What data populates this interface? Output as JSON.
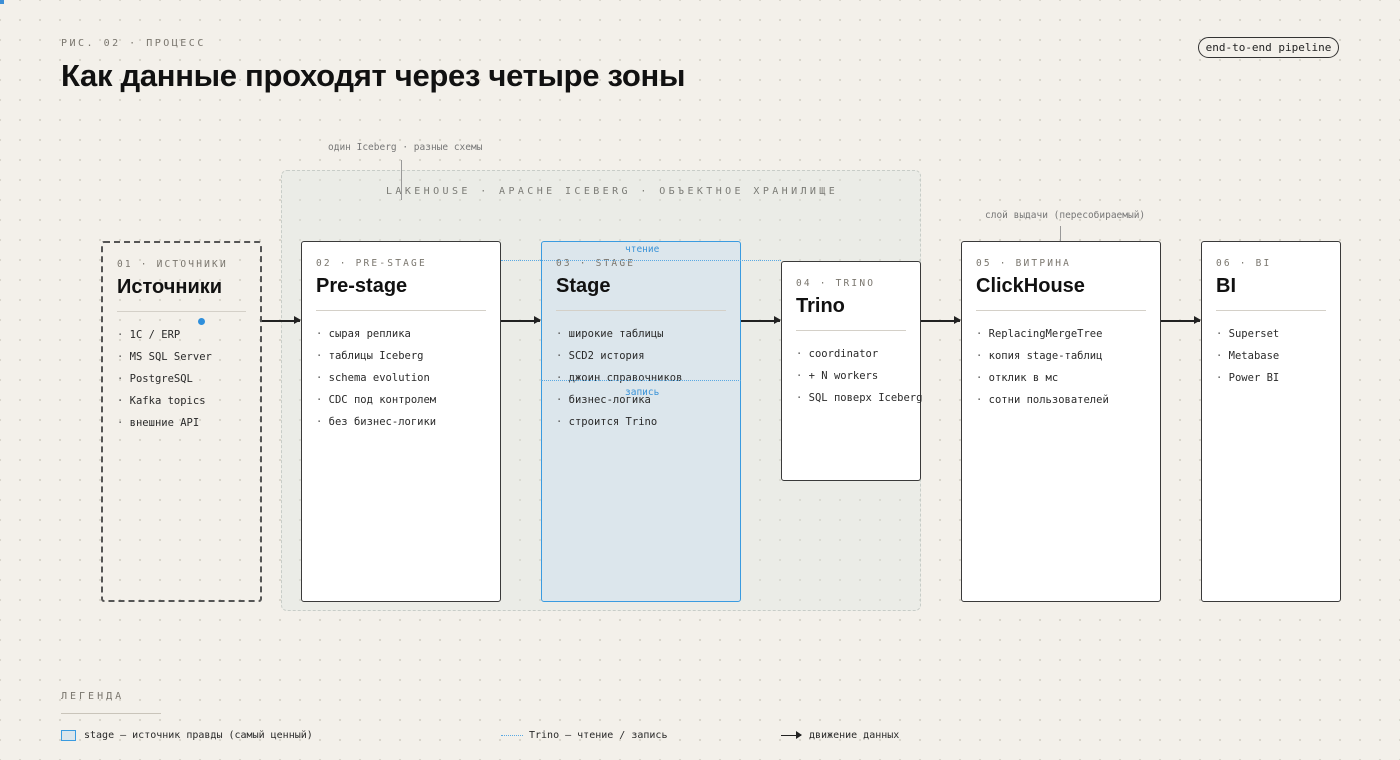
{
  "header": {
    "fig_label": "РИС. 02 · ПРОЦЕСС",
    "title": "Как данные проходят через четыре зоны",
    "pill": "end-to-end pipeline"
  },
  "lakehouse": {
    "note": "один Iceberg · разные схемы",
    "label": "LAKEHOUSE · APACHE ICEBERG · ОБЪЕКТНОЕ ХРАНИЛИЩЕ"
  },
  "serve_note": "слой выдачи (пересобираемый)",
  "zones": [
    {
      "code": "01 · ИСТОЧНИКИ",
      "title": "Источники",
      "items": [
        "1С / ERP",
        "MS SQL Server",
        "PostgreSQL",
        "Kafka topics",
        "внешние API"
      ]
    },
    {
      "code": "02 · PRE-STAGE",
      "title": "Pre-stage",
      "items": [
        "сырая реплика",
        "таблицы Iceberg",
        "schema evolution",
        "CDC под контролем",
        "без бизнес-логики"
      ]
    },
    {
      "code": "03 · STAGE",
      "title": "Stage",
      "items": [
        "широкие таблицы",
        "SCD2 история",
        "джоин справочников",
        "бизнес-логика",
        "строится Trino"
      ]
    },
    {
      "code": "04 · TRINO",
      "title": "Trino",
      "items": [
        "coordinator",
        "+ N workers",
        "SQL поверх Iceberg"
      ]
    },
    {
      "code": "05 · ВИТРИНА",
      "title": "ClickHouse",
      "items": [
        "ReplacingMergeTree",
        "копия stage-таблиц",
        "отклик в мс",
        "сотни пользователей"
      ]
    },
    {
      "code": "06 · BI",
      "title": "BI",
      "items": [
        "Superset",
        "Metabase",
        "Power BI"
      ]
    }
  ],
  "trino_links": {
    "read": "чтение",
    "write": "запись"
  },
  "legend": {
    "title": "ЛЕГЕНДА",
    "stage": "stage — источник правды (самый ценный)",
    "trino": "Trino — чтение / запись",
    "flow": "движение данных"
  },
  "colors": {
    "accent": "#3a9be0",
    "stage_fill": "#dce6ec",
    "background": "#f3f0ea"
  }
}
